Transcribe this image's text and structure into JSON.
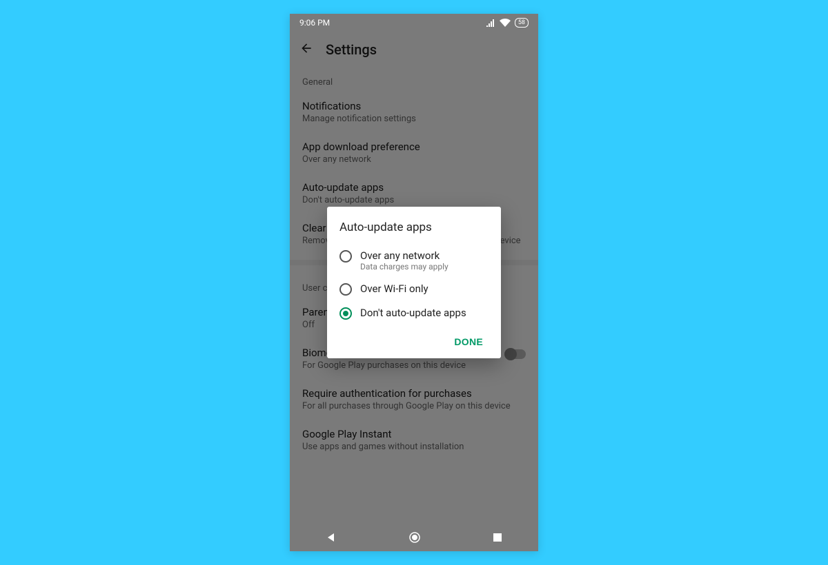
{
  "statusbar": {
    "time": "9:06 PM",
    "battery": "58"
  },
  "appbar": {
    "title": "Settings"
  },
  "sections": {
    "general_label": "General",
    "notifications": {
      "title": "Notifications",
      "sub": "Manage notification settings"
    },
    "download_pref": {
      "title": "App download preference",
      "sub": "Over any network"
    },
    "auto_update": {
      "title": "Auto-update apps",
      "sub": "Don't auto-update apps"
    },
    "clear_history": {
      "title": "Clear local search history",
      "sub": "Remove searches you have performed from this device"
    },
    "user_label": "User controls",
    "parental": {
      "title": "Parental controls",
      "sub": "Off"
    },
    "biometric": {
      "title": "Biometric authentication",
      "sub": "For Google Play purchases on this device"
    },
    "require_auth": {
      "title": "Require authentication for purchases",
      "sub": "For all purchases through Google Play on this device"
    },
    "instant": {
      "title": "Google Play Instant",
      "sub": "Use apps and games without installation"
    }
  },
  "dialog": {
    "title": "Auto-update apps",
    "options": [
      {
        "label": "Over any network",
        "sub": "Data charges may apply",
        "checked": false
      },
      {
        "label": "Over Wi-Fi only",
        "sub": "",
        "checked": false
      },
      {
        "label": "Don't auto-update apps",
        "sub": "",
        "checked": true
      }
    ],
    "done": "DONE"
  }
}
